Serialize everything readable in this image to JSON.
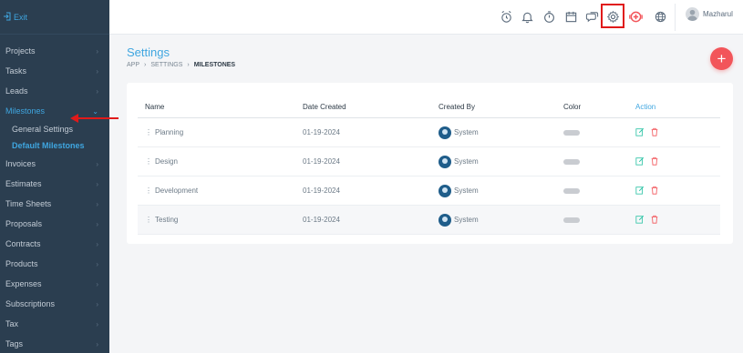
{
  "sidebar": {
    "exit_label": "Exit",
    "items": [
      {
        "label": "Projects"
      },
      {
        "label": "Tasks"
      },
      {
        "label": "Leads"
      },
      {
        "label": "Milestones"
      },
      {
        "label": "Invoices"
      },
      {
        "label": "Estimates"
      },
      {
        "label": "Time Sheets"
      },
      {
        "label": "Proposals"
      },
      {
        "label": "Contracts"
      },
      {
        "label": "Products"
      },
      {
        "label": "Expenses"
      },
      {
        "label": "Subscriptions"
      },
      {
        "label": "Tax"
      },
      {
        "label": "Tags"
      }
    ],
    "submenu": [
      {
        "label": "General Settings"
      },
      {
        "label": "Default Milestones"
      }
    ]
  },
  "topbar": {
    "icons": [
      "alarm-icon",
      "bell-icon",
      "timer-icon",
      "calendar-icon",
      "chat-icon",
      "gear-icon",
      "add-circle-icon",
      "globe-icon"
    ],
    "user_name": "Mazharul"
  },
  "page": {
    "title": "Settings",
    "breadcrumb": [
      "APP",
      "SETTINGS",
      "MILESTONES"
    ]
  },
  "table": {
    "headers": {
      "name": "Name",
      "date": "Date Created",
      "by": "Created By",
      "color": "Color",
      "action": "Action"
    },
    "rows": [
      {
        "name": "Planning",
        "date": "01-19-2024",
        "by": "System"
      },
      {
        "name": "Design",
        "date": "01-19-2024",
        "by": "System"
      },
      {
        "name": "Development",
        "date": "01-19-2024",
        "by": "System"
      },
      {
        "name": "Testing",
        "date": "01-19-2024",
        "by": "System"
      }
    ]
  },
  "colors": {
    "sidebar_bg": "#2b3e50",
    "accent": "#3fa6e0",
    "fab": "#f2555a",
    "edit_icon": "#2ec4a6",
    "delete_icon": "#f2555a",
    "highlight_box": "#e01a1a",
    "arrow": "#e01a1a"
  }
}
